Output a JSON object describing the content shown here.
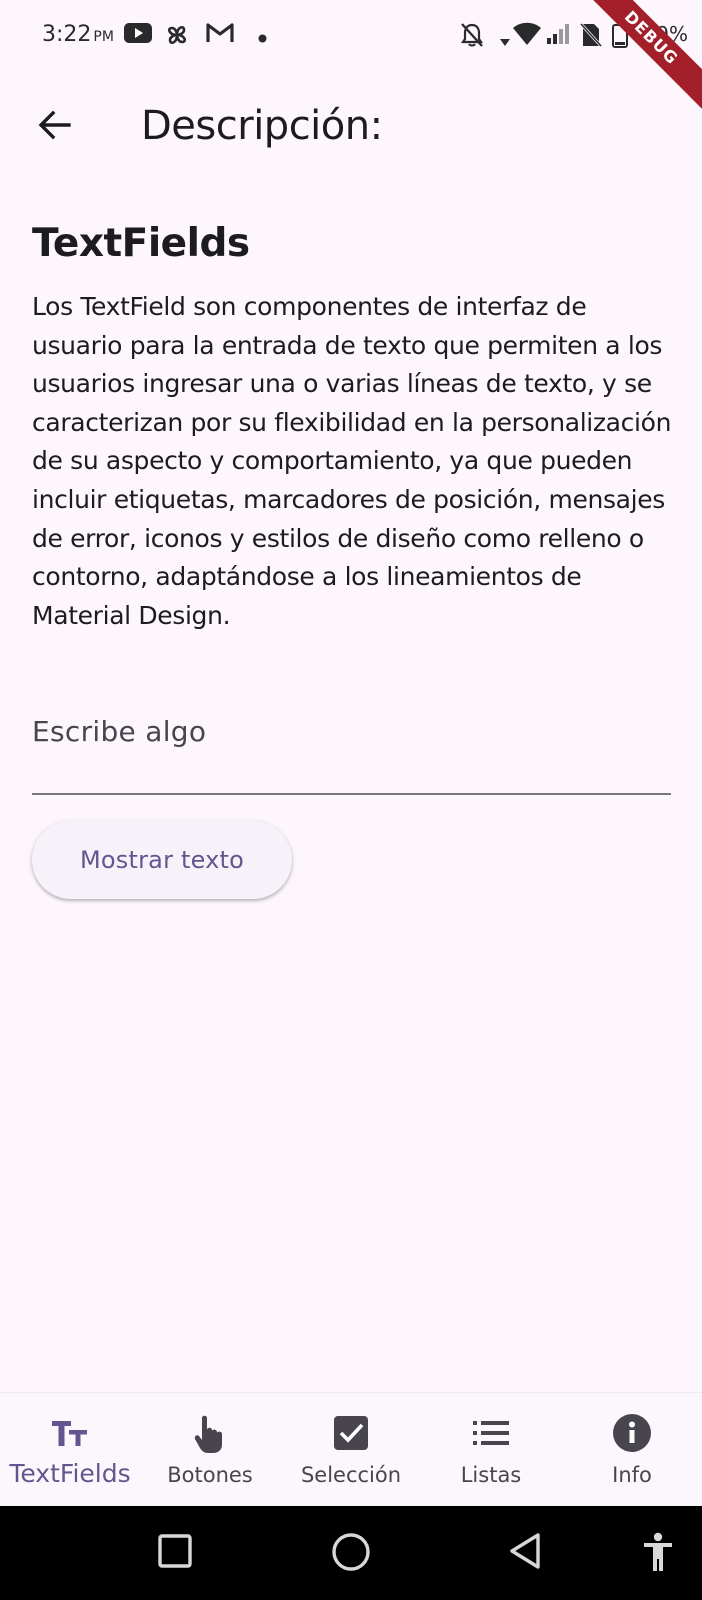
{
  "status_bar": {
    "time": "3:22",
    "ampm": "PM",
    "battery": "9%",
    "debug_banner": "DEBUG",
    "icons": [
      "youtube-icon",
      "pinwheel-icon",
      "gmail-icon",
      "notification-dot-icon",
      "mute-icon",
      "wifi-icon",
      "signal-icon",
      "no-sim-icon",
      "battery-icon"
    ]
  },
  "app_bar": {
    "title": "Descripción:",
    "back_icon": "arrow-back-icon"
  },
  "content": {
    "heading": "TextFields",
    "description": "Los TextField son componentes de interfaz de usuario para la entrada de texto que permiten a los usuarios ingresar una o varias líneas de texto, y se caracterizan por su flexibilidad en la personalización de su aspecto y comportamiento, ya que pueden incluir etiquetas, marcadores de posición, mensajes de error, iconos y estilos de diseño como relleno o contorno, adaptándose a los lineamientos de Material Design."
  },
  "text_field": {
    "placeholder": "Escribe algo",
    "value": ""
  },
  "show_button": {
    "label": "Mostrar texto"
  },
  "bottom_nav": {
    "items": [
      {
        "label": "TextFields",
        "icon": "text-fields-icon",
        "active": true
      },
      {
        "label": "Botones",
        "icon": "touch-icon",
        "active": false
      },
      {
        "label": "Selección",
        "icon": "checkbox-icon",
        "active": false
      },
      {
        "label": "Listas",
        "icon": "list-icon",
        "active": false
      },
      {
        "label": "Info",
        "icon": "info-icon",
        "active": false
      }
    ]
  },
  "system_nav": {
    "icons": [
      "recents-icon",
      "home-icon",
      "back-icon",
      "accessibility-icon"
    ]
  },
  "colors": {
    "background": "#fdf7fd",
    "accent": "#65558f",
    "text": "#1c1b1f",
    "debug_banner": "#a3202a"
  }
}
